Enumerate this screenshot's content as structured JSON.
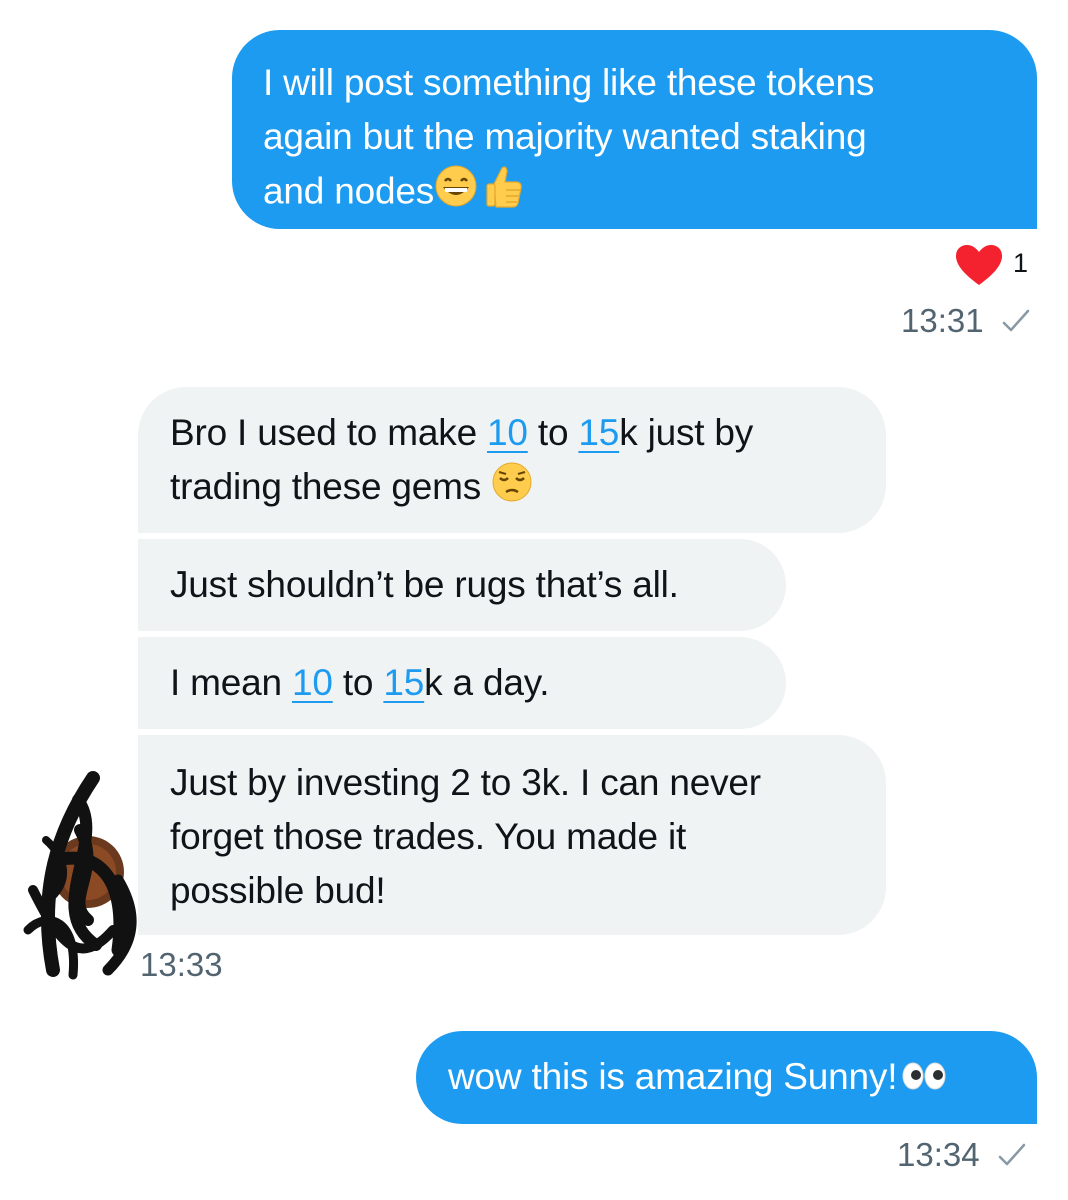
{
  "messages": {
    "m1": {
      "line1": "I will post something like these tokens",
      "line2": "again but the majority wanted staking",
      "line3": "and nodes",
      "emojis": [
        "grinning-face-icon",
        "thumbs-up-icon"
      ],
      "reaction_count": "1",
      "time": "13:31"
    },
    "m2": {
      "l1_a": "Bro I used to make ",
      "l1_link1": "10",
      "l1_b": " to ",
      "l1_link2": "15",
      "l1_c": "k just by",
      "l2": "trading these gems ",
      "emoji": "pensive-face-icon"
    },
    "m3": {
      "text": "Just shouldn’t be rugs that’s all."
    },
    "m4": {
      "a": "I mean ",
      "link1": "10",
      "b": " to ",
      "link2": "15",
      "c": "k a day."
    },
    "m5": {
      "line1": "Just by investing 2 to 3k. I can never",
      "line2": "forget those trades. You made it",
      "line3": "possible bud!",
      "time": "13:33"
    },
    "m6": {
      "text": "wow this is amazing Sunny!",
      "emoji": "eyes-icon",
      "time": "13:34"
    }
  },
  "colors": {
    "sent_bubble": "#1d9bf0",
    "received_bubble": "#eff3f4",
    "link": "#1d9bf0",
    "heart": "#f4212e",
    "meta_text": "#536471"
  }
}
